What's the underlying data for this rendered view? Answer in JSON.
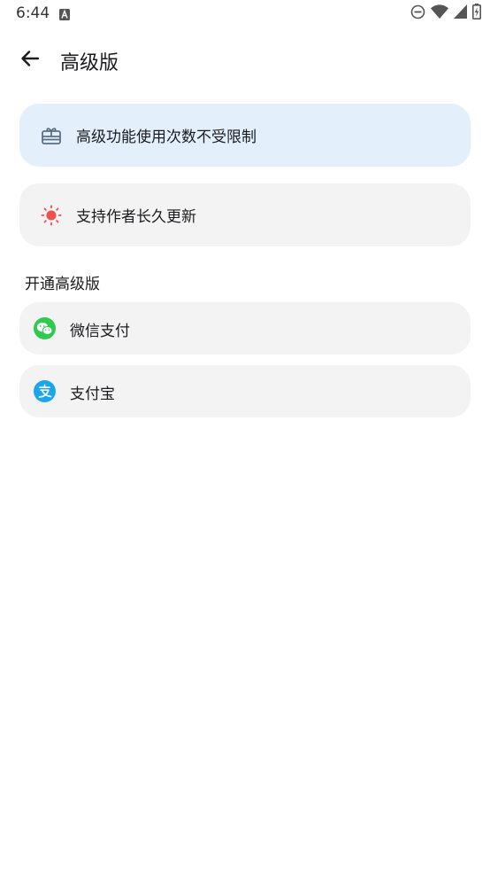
{
  "status_bar": {
    "time": "6:44",
    "notification_icon": "font-download-icon",
    "icons": [
      "do-not-disturb-icon",
      "wifi-icon",
      "cellular-signal-icon",
      "battery-charging-icon"
    ]
  },
  "header": {
    "back_icon": "arrow-back-icon",
    "title": "高级版"
  },
  "benefits": [
    {
      "icon": "gift-card-icon",
      "label": "高级功能使用次数不受限制",
      "color": "#5a6e85"
    },
    {
      "icon": "sun-icon",
      "label": "支持作者长久更新",
      "color": "#ef4e4e"
    }
  ],
  "purchase": {
    "section_title": "开通高级版",
    "options": [
      {
        "icon": "wechat-pay-icon",
        "label": "微信支付",
        "color": "#2ec94f"
      },
      {
        "icon": "alipay-icon",
        "label": "支付宝",
        "color": "#1aa6ec"
      }
    ]
  }
}
